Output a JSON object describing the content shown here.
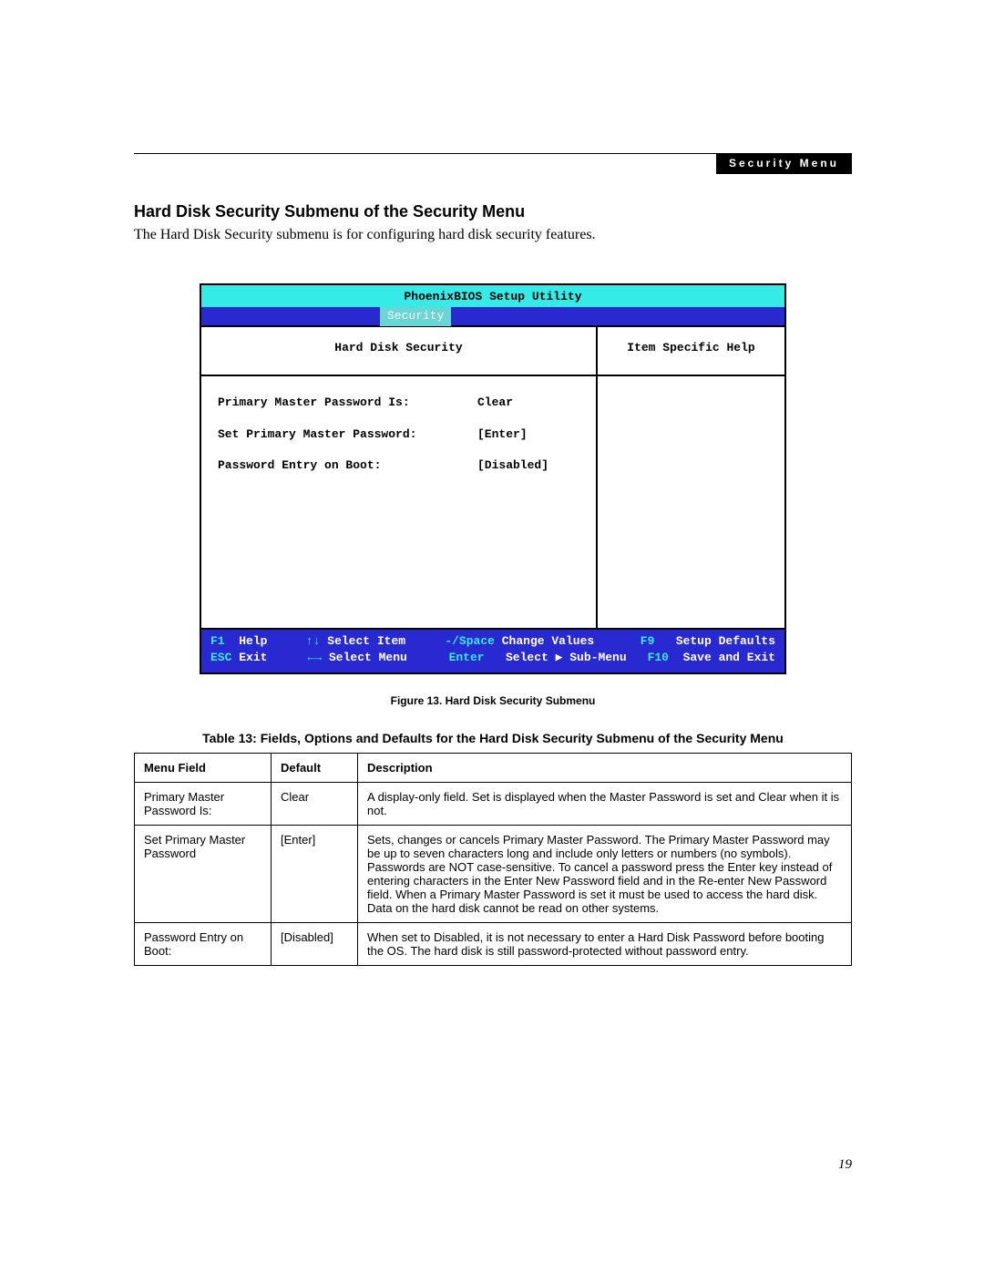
{
  "header": {
    "tag": "Security Menu",
    "section_title": "Hard Disk Security Submenu of the Security Menu",
    "intro": "The Hard Disk Security submenu is for configuring hard disk security features."
  },
  "bios": {
    "utility_title": "PhoenixBIOS Setup Utility",
    "active_tab": "Security",
    "panel_title": "Hard Disk Security",
    "help_title": "Item Specific Help",
    "fields": [
      {
        "label": "Primary Master Password Is:",
        "value": "Clear"
      },
      {
        "label": "Set Primary Master Password:",
        "value": "[Enter]"
      },
      {
        "label": "Password Entry on Boot:",
        "value": "[Disabled]"
      }
    ],
    "footer": {
      "row1": {
        "k1": "F1",
        "t1": "Help",
        "k2": "↑↓",
        "t2": "Select Item",
        "k3": "-/Space",
        "t3": "Change Values",
        "k4": "F9",
        "t4": "Setup Defaults"
      },
      "row2": {
        "k1": "ESC",
        "t1": "Exit",
        "k2": "←→",
        "t2": "Select Menu",
        "k3": "Enter",
        "t3": "Select ▶ Sub-Menu",
        "k4": "F10",
        "t4": "Save and Exit"
      }
    }
  },
  "figure": {
    "label": "Figure 13.   Hard Disk Security Submenu"
  },
  "table": {
    "caption": "Table 13: Fields, Options and Defaults for the Hard Disk Security Submenu of the Security Menu",
    "headers": {
      "c1": "Menu Field",
      "c2": "Default",
      "c3": "Description"
    },
    "rows": [
      {
        "field": "Primary Master Password Is:",
        "default": "Clear",
        "desc": "A display-only field. Set is displayed when the Master Password is set and Clear when it is not."
      },
      {
        "field": "Set Primary Master Password",
        "default": "[Enter]",
        "desc": "Sets, changes or cancels Primary Master Password. The Primary Master Password may be up to seven characters long and include only letters or numbers (no symbols). Passwords are NOT case-sensitive. To cancel a password press the Enter key instead of entering characters in the Enter New Password field and in the Re-enter New Password field. When a Primary Master Password is set it must be used to access the hard disk. Data on the hard disk cannot be read on other systems."
      },
      {
        "field": "Password Entry on Boot:",
        "default": "[Disabled]",
        "desc": "When set to Disabled, it is not necessary to enter a Hard Disk Password before booting the OS. The hard disk is still password-protected without password entry."
      }
    ]
  },
  "page_number": "19"
}
